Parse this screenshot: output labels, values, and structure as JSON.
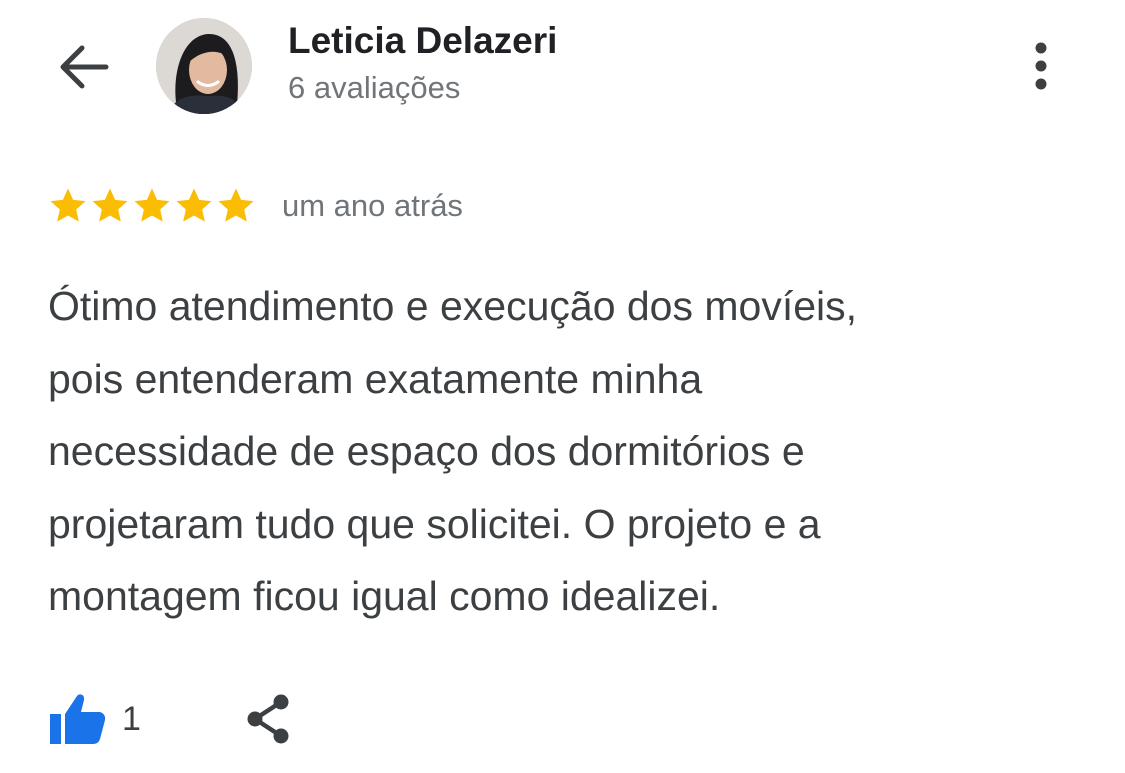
{
  "reviewer": {
    "name": "Leticia Delazeri",
    "review_count": "6 avaliações"
  },
  "review": {
    "rating": 5,
    "max_rating": 5,
    "time": "um ano atrás",
    "text": "Ótimo atendimento e execução dos movíeis,\npois entenderam exatamente minha\nnecessidade de espaço dos dormitórios e\nprojetaram tudo que solicitei. O projeto e a\nmontagem ficou igual como idealizei."
  },
  "actions": {
    "like_count": "1",
    "like_icon": "thumbs-up-icon",
    "share_icon": "share-icon"
  },
  "header": {
    "back_icon": "arrow-back-icon",
    "more_icon": "more-vert-icon"
  },
  "colors": {
    "star": "#FBBC04",
    "like_blue": "#1A73E8",
    "name_text": "#202124",
    "secondary_text": "#70757A",
    "body_text": "#3C4043"
  }
}
